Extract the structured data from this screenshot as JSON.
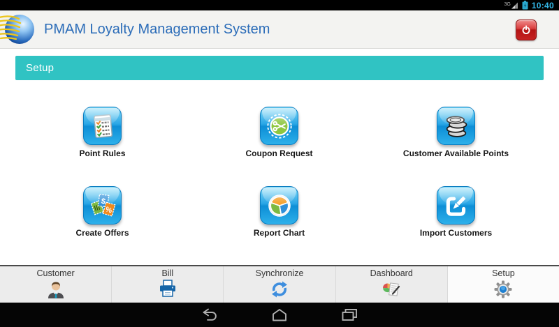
{
  "status_bar": {
    "network_label": "3G",
    "time": "10:40"
  },
  "header": {
    "title": "PMAM Loyalty Management System"
  },
  "banner": {
    "title": "Setup"
  },
  "tiles": [
    {
      "label": "Point Rules",
      "icon": "point-rules-icon"
    },
    {
      "label": "Coupon Request",
      "icon": "coupon-request-icon"
    },
    {
      "label": "Customer Available Points",
      "icon": "customer-points-icon"
    },
    {
      "label": "Create Offers",
      "icon": "create-offers-icon"
    },
    {
      "label": "Report Chart",
      "icon": "report-chart-icon"
    },
    {
      "label": "Import Customers",
      "icon": "import-customers-icon"
    }
  ],
  "tabs": [
    {
      "label": "Customer",
      "icon": "customer-icon",
      "selected": false
    },
    {
      "label": "Bill",
      "icon": "printer-icon",
      "selected": false
    },
    {
      "label": "Synchronize",
      "icon": "sync-icon",
      "selected": false
    },
    {
      "label": "Dashboard",
      "icon": "dashboard-icon",
      "selected": false
    },
    {
      "label": "Setup",
      "icon": "gear-icon",
      "selected": true
    }
  ],
  "colors": {
    "accent_teal": "#30c3c3",
    "title_blue": "#2b6cb8",
    "tile_blue": "#18a0e0",
    "power_red": "#c41e1e",
    "status_time_blue": "#33b5e5"
  }
}
